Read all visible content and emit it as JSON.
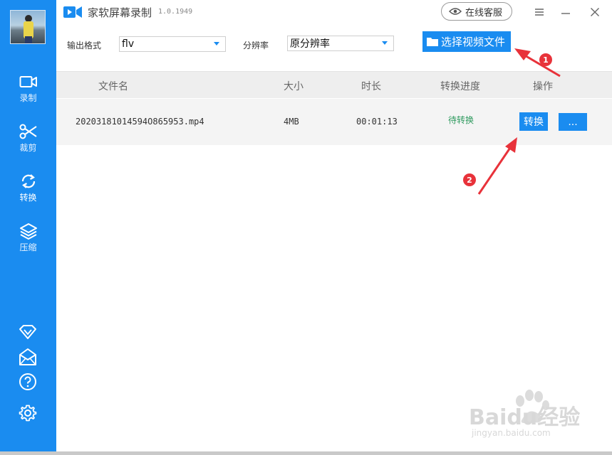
{
  "app": {
    "title": "家软屏幕录制",
    "version": "1.0.1949",
    "support_label": "在线客服"
  },
  "colors": {
    "accent": "#1a8cf0",
    "status_green": "#2e9a5e",
    "annotation_red": "#e8323a"
  },
  "sidebar": {
    "items": [
      {
        "label": "录制",
        "icon": "video-camera-icon"
      },
      {
        "label": "裁剪",
        "icon": "scissors-icon"
      },
      {
        "label": "转换",
        "icon": "refresh-icon"
      },
      {
        "label": "压缩",
        "icon": "layers-icon"
      }
    ],
    "bottom_icons": [
      "diamond-icon",
      "mail-icon",
      "help-icon",
      "gear-icon"
    ]
  },
  "options": {
    "format_label": "输出格式",
    "format_value": "flv",
    "resolution_label": "分辨率",
    "resolution_value": "原分辨率",
    "choose_button": "选择视频文件"
  },
  "table": {
    "headers": [
      "文件名",
      "大小",
      "时长",
      "转换进度",
      "操作"
    ],
    "rows": [
      {
        "filename": "20203181014594O865953.mp4",
        "size": "4MB",
        "duration": "00:01:13",
        "status": "待转换",
        "convert_label": "转换",
        "more_label": "..."
      }
    ]
  },
  "annotations": {
    "badge1": "1",
    "badge2": "2"
  },
  "watermark": {
    "brand": "Baidu经验",
    "url": "jingyan.baidu.com"
  }
}
